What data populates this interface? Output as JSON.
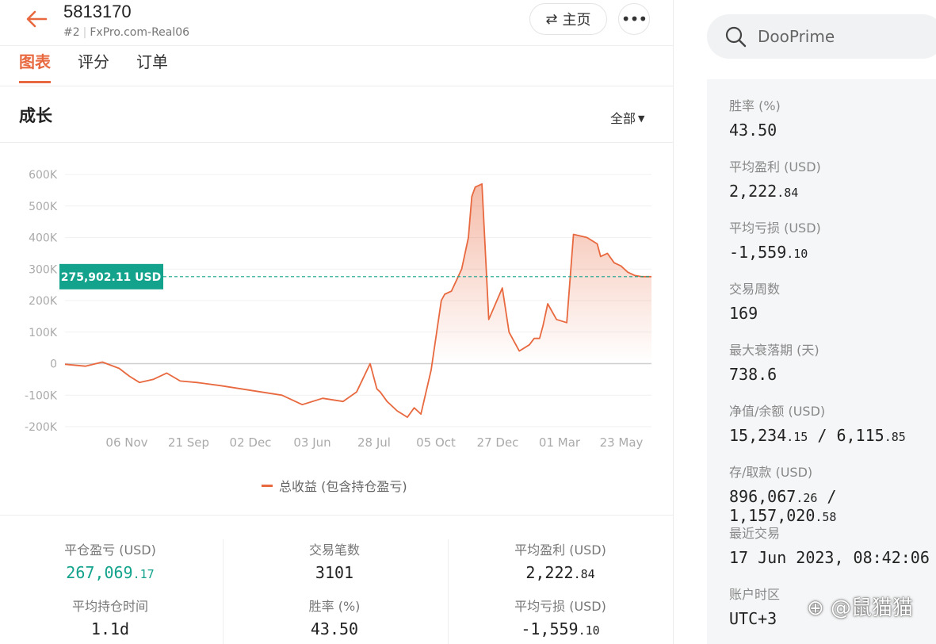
{
  "header": {
    "account_id": "5813170",
    "rank": "#2",
    "server": "FxPro.com-Real06",
    "home_label": "主页",
    "more_label": "•••"
  },
  "tabs": [
    {
      "label": "图表",
      "active": true
    },
    {
      "label": "评分",
      "active": false
    },
    {
      "label": "订单",
      "active": false
    }
  ],
  "section": {
    "title": "成长",
    "range_label": "全部"
  },
  "chart_data": {
    "type": "area",
    "x_labels": [
      "06 Nov",
      "21 Sep",
      "02 Dec",
      "03 Jun",
      "28 Jul",
      "05 Oct",
      "27 Dec",
      "01 Mar",
      "23 May"
    ],
    "y_ticks": [
      "600K",
      "500K",
      "400K",
      "300K",
      "200K",
      "100K",
      "0",
      "-100K",
      "-200K"
    ],
    "ylim": [
      -200000,
      600000
    ],
    "current_value_label": "275,902.11 USD",
    "current_value": 275902.11,
    "series": [
      {
        "name": "总收益 (包含持仓盈亏)",
        "color": "#e8693f",
        "x": [
          0.0,
          0.3,
          0.55,
          0.8,
          0.95,
          1.1,
          1.3,
          1.5,
          1.7,
          1.95,
          2.3,
          2.6,
          2.9,
          3.2,
          3.5,
          3.8,
          4.1,
          4.3,
          4.5,
          4.6,
          4.65,
          4.75,
          4.9,
          5.05,
          5.15,
          5.25,
          5.4,
          5.55,
          5.6,
          5.7,
          5.85,
          5.95,
          6.0,
          6.05,
          6.15,
          6.25,
          6.45,
          6.55,
          6.7,
          6.85,
          6.92,
          7.0,
          7.05,
          7.12,
          7.25,
          7.4,
          7.5,
          7.7,
          7.85,
          7.9,
          8.0,
          8.1,
          8.2,
          8.3,
          8.4,
          8.5,
          8.65
        ],
        "values": [
          -2000,
          -8000,
          5000,
          -15000,
          -40000,
          -60000,
          -50000,
          -30000,
          -55000,
          -60000,
          -70000,
          -80000,
          -90000,
          -100000,
          -130000,
          -110000,
          -120000,
          -90000,
          0,
          -80000,
          -90000,
          -120000,
          -150000,
          -170000,
          -140000,
          -160000,
          -20000,
          200000,
          220000,
          230000,
          300000,
          400000,
          530000,
          560000,
          570000,
          140000,
          240000,
          100000,
          40000,
          60000,
          80000,
          80000,
          120000,
          190000,
          140000,
          130000,
          410000,
          400000,
          380000,
          340000,
          350000,
          320000,
          310000,
          290000,
          280000,
          275902,
          275902
        ]
      }
    ],
    "grid": true
  },
  "stats": [
    {
      "label": "平仓盈亏 (USD)",
      "value": "267,069",
      "decimals": ".17",
      "green": true
    },
    {
      "label": "交易笔数",
      "value": "3101",
      "decimals": "",
      "green": false
    },
    {
      "label": "平均盈利 (USD)",
      "value": "2,222",
      "decimals": ".84",
      "green": false
    },
    {
      "label": "平均持仓时间",
      "value": "1.1d",
      "decimals": "",
      "green": false
    },
    {
      "label": "胜率 (%)",
      "value": "43.50",
      "decimals": "",
      "green": false
    },
    {
      "label": "平均亏损 (USD)",
      "value": "-1,559",
      "decimals": ".10",
      "green": false
    }
  ],
  "search": {
    "placeholder": "DooPrime"
  },
  "info": [
    {
      "label": "胜率 (%)",
      "value": "43.50",
      "decimals": ""
    },
    {
      "label": "平均盈利 (USD)",
      "value": "2,222",
      "decimals": ".84"
    },
    {
      "label": "平均亏损 (USD)",
      "value": "-1,559",
      "decimals": ".10"
    },
    {
      "label": "交易周数",
      "value": "169",
      "decimals": ""
    },
    {
      "label": "最大衰落期 (天)",
      "value": "738.6",
      "decimals": ""
    },
    {
      "label": "净值/余额 (USD)",
      "value": "15,234",
      "decimals": ".15",
      "value2": "6,115",
      "decimals2": ".85"
    },
    {
      "label": "存/取款 (USD)",
      "value": "896,067",
      "decimals": ".26",
      "value2": "1,157,020",
      "decimals2": ".58"
    },
    {
      "label": "最近交易",
      "value": "17 Jun 2023, 08:42:06",
      "decimals": ""
    },
    {
      "label": "账户时区",
      "value": "UTC+3",
      "decimals": ""
    }
  ],
  "watermark": "⊕ @鼠猫猫",
  "colors": {
    "accent": "#e8693f",
    "green": "#13a38c",
    "panel": "#f5f6f7"
  }
}
